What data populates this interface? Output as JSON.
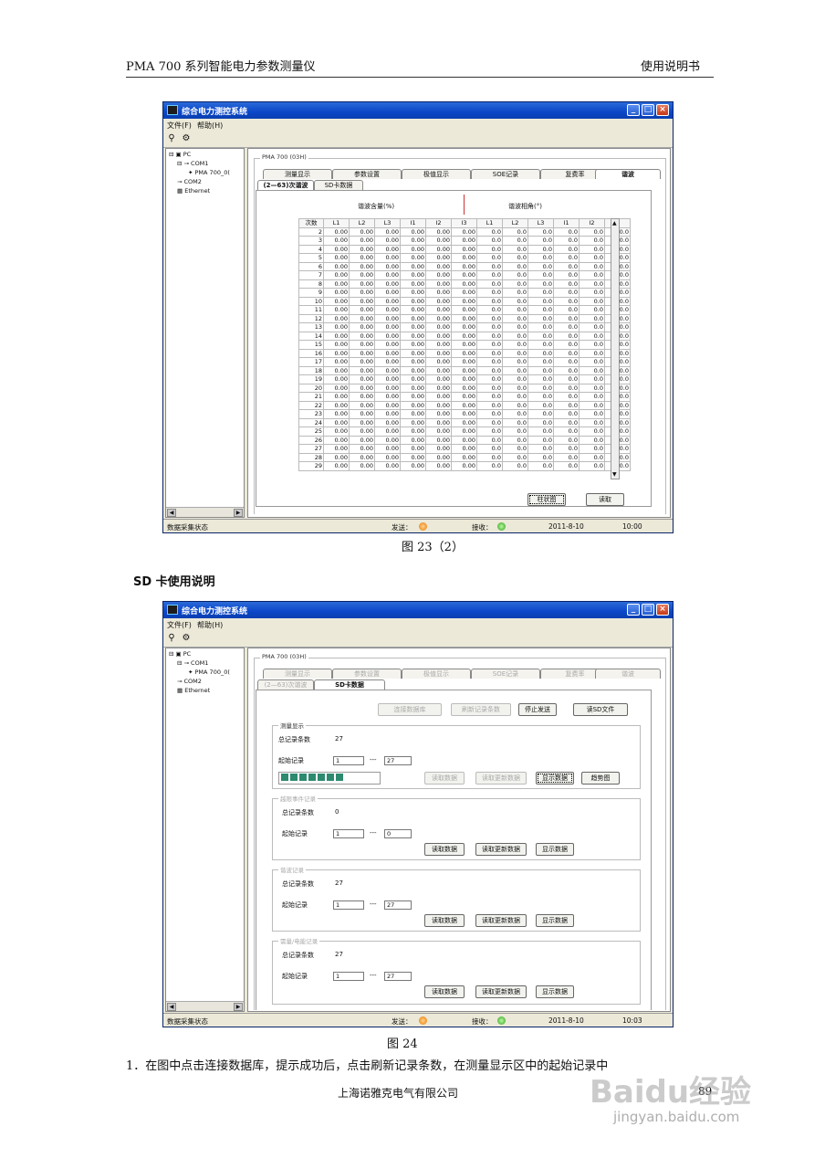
{
  "header": {
    "left": "PMA 700  系列智能电力参数测量仪",
    "right": "使用说明书"
  },
  "window": {
    "title": "综合电力测控系统",
    "menu": [
      "文件(F)",
      "帮助(H)"
    ],
    "tree": [
      "PC",
      "COM1",
      "PMA 700_0(",
      "COM2",
      "Ethernet"
    ],
    "device_group": "PMA 700 (03H)",
    "tabs": [
      "测量显示",
      "参数设置",
      "极值显示",
      "SOE记录",
      "复费率",
      "谐波"
    ],
    "subtabs": [
      "(2—63)次谐波",
      "SD卡数据"
    ],
    "status": {
      "left": "数据采集状态",
      "send": "发送：",
      "recv": "接收：",
      "date": "2011-8-10"
    }
  },
  "fig1": {
    "time": "10:00",
    "col_group_1": "谐波含量(%)",
    "col_group_2": "谐波相角(°)",
    "columns": [
      "次数",
      "L1",
      "L2",
      "L3",
      "I1",
      "I2",
      "I3",
      "L1",
      "L2",
      "L3",
      "I1",
      "I2",
      "I3"
    ],
    "row_start": 2,
    "row_end": 29,
    "value_content": "0.00",
    "value_angle": "0.0",
    "btn_bar": "柱状图",
    "btn_read": "读取",
    "caption": "图 23（2）"
  },
  "section_title": "SD 卡使用说明",
  "fig2": {
    "time": "10:03",
    "btn_connect": "连接数据库",
    "btn_refresh": "刷新记录条数",
    "btn_stop": "停止发送",
    "btn_readsd": "读SD文件",
    "groups": [
      {
        "label": "测量显示",
        "total_label": "总记录条数",
        "total": "27",
        "start_label": "起始记录",
        "from": "1",
        "dash": "---",
        "to": "27",
        "b1": "读取数据",
        "b2": "读取更新数据",
        "b3": "显示数据",
        "b4": "趋势图",
        "progress_blocks": 7
      },
      {
        "label": "越限事件记录",
        "total_label": "总记录条数",
        "total": "0",
        "start_label": "起始记录",
        "from": "1",
        "dash": "---",
        "to": "0",
        "b1": "读取数据",
        "b2": "读取更新数据",
        "b3": "显示数据"
      },
      {
        "label": "谐波记录",
        "total_label": "总记录条数",
        "total": "27",
        "start_label": "起始记录",
        "from": "1",
        "dash": "---",
        "to": "27",
        "b1": "读取数据",
        "b2": "读取更新数据",
        "b3": "显示数据"
      },
      {
        "label": "需量/电能记录",
        "total_label": "总记录条数",
        "total": "27",
        "start_label": "起始记录",
        "from": "1",
        "dash": "---",
        "to": "27",
        "b1": "读取数据",
        "b2": "读取更新数据",
        "b3": "显示数据"
      }
    ],
    "caption": "图 24"
  },
  "paragraph": "1．在图中点击连接数据库，提示成功后，点击刷新记录条数，在测量显示区中的起始记录中",
  "footer": {
    "company": "上海诺雅克电气有限公司",
    "page": "89"
  },
  "watermark": {
    "logo": "Baidu经验",
    "url": "jingyan.baidu.com"
  }
}
